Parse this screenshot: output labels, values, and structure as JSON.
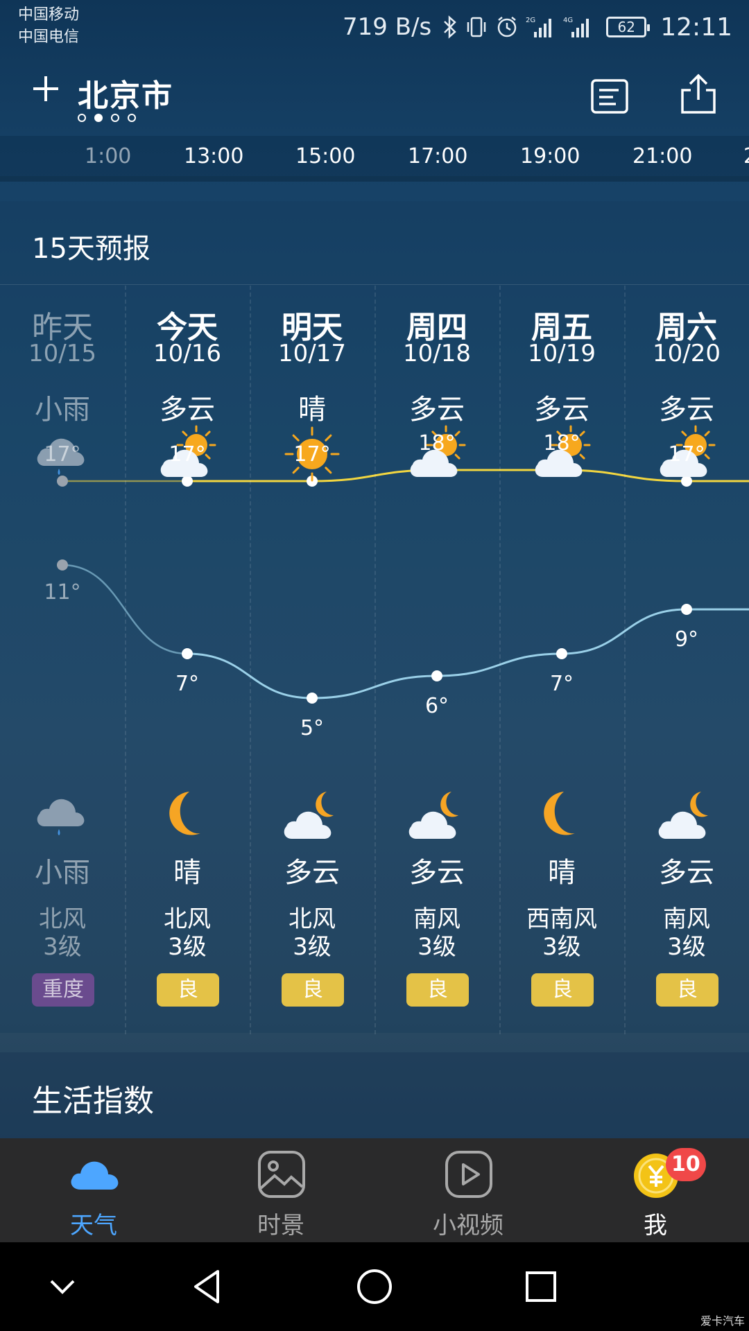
{
  "status": {
    "carriers": [
      "中国移动",
      "中国电信"
    ],
    "speed": "719 B/s",
    "battery": "62",
    "time": "12:11"
  },
  "header": {
    "city": "北京市",
    "page_count": 4,
    "active_page": 1
  },
  "hourly": {
    "times": [
      "1:00",
      "13:00",
      "15:00",
      "17:00",
      "19:00",
      "21:00",
      "2"
    ]
  },
  "forecast": {
    "title": "15天预报",
    "days": [
      {
        "name": "昨天",
        "date": "10/15",
        "day_cond": "小雨",
        "day_icon": "rain-cloud-icon",
        "high": "17°",
        "low": "11°",
        "night_cond": "小雨",
        "night_icon": "rain-cloud-icon",
        "wind_dir": "北风",
        "wind_level": "3级",
        "aqi": "重度",
        "aqi_color": "#6a4b8e",
        "past": true
      },
      {
        "name": "今天",
        "date": "10/16",
        "day_cond": "多云",
        "day_icon": "partly-cloudy-day-icon",
        "high": "17°",
        "low": "7°",
        "night_cond": "晴",
        "night_icon": "moon-icon",
        "wind_dir": "北风",
        "wind_level": "3级",
        "aqi": "良",
        "aqi_color": "#e4c247",
        "past": false
      },
      {
        "name": "明天",
        "date": "10/17",
        "day_cond": "晴",
        "day_icon": "sun-icon",
        "high": "17°",
        "low": "5°",
        "night_cond": "多云",
        "night_icon": "partly-cloudy-night-icon",
        "wind_dir": "北风",
        "wind_level": "3级",
        "aqi": "良",
        "aqi_color": "#e4c247",
        "past": false
      },
      {
        "name": "周四",
        "date": "10/18",
        "day_cond": "多云",
        "day_icon": "partly-cloudy-day-icon",
        "high": "18°",
        "low": "6°",
        "night_cond": "多云",
        "night_icon": "partly-cloudy-night-icon",
        "wind_dir": "南风",
        "wind_level": "3级",
        "aqi": "良",
        "aqi_color": "#e4c247",
        "past": false
      },
      {
        "name": "周五",
        "date": "10/19",
        "day_cond": "多云",
        "day_icon": "partly-cloudy-day-icon",
        "high": "18°",
        "low": "7°",
        "night_cond": "晴",
        "night_icon": "moon-icon",
        "wind_dir": "西南风",
        "wind_level": "3级",
        "aqi": "良",
        "aqi_color": "#e4c247",
        "past": false
      },
      {
        "name": "周六",
        "date": "10/20",
        "day_cond": "多云",
        "day_icon": "partly-cloudy-day-icon",
        "high": "17°",
        "low": "9°",
        "night_cond": "多云",
        "night_icon": "partly-cloudy-night-icon",
        "wind_dir": "南风",
        "wind_level": "3级",
        "aqi": "良",
        "aqi_color": "#e4c247",
        "past": false
      }
    ],
    "high_line_color": "#f2d640",
    "low_line_color": "#9ad0e8"
  },
  "life": {
    "title": "生活指数"
  },
  "tabs": [
    {
      "label": "天气",
      "icon": "cloud-icon",
      "active": true
    },
    {
      "label": "时景",
      "icon": "photo-icon",
      "active": false
    },
    {
      "label": "小视频",
      "icon": "play-icon",
      "active": false
    },
    {
      "label": "我",
      "icon": "coin-icon",
      "active": false,
      "badge": "10"
    }
  ],
  "watermark": "爱卡汽车"
}
